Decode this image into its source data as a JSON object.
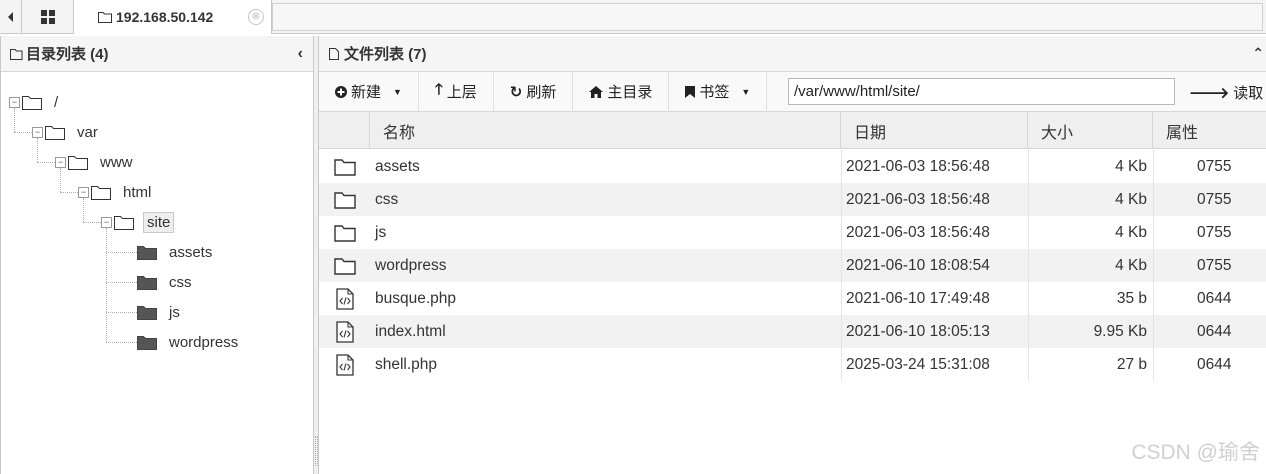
{
  "tabbar": {
    "active_tab": "192.168.50.142",
    "close_glyph": "⊗"
  },
  "left_panel": {
    "title": "目录列表 (4)",
    "tree": [
      {
        "label": "/",
        "depth": 0,
        "type": "folder-open"
      },
      {
        "label": "var",
        "depth": 1,
        "type": "folder-open"
      },
      {
        "label": "www",
        "depth": 2,
        "type": "folder-open"
      },
      {
        "label": "html",
        "depth": 3,
        "type": "folder-open"
      },
      {
        "label": "site",
        "depth": 4,
        "type": "folder-open",
        "selected": true
      },
      {
        "label": "assets",
        "depth": 5,
        "type": "folder-closed"
      },
      {
        "label": "css",
        "depth": 5,
        "type": "folder-closed"
      },
      {
        "label": "js",
        "depth": 5,
        "type": "folder-closed"
      },
      {
        "label": "wordpress",
        "depth": 5,
        "type": "folder-closed"
      }
    ]
  },
  "right_panel": {
    "title": "文件列表 (7)",
    "toolbar": {
      "new_label": "新建",
      "up_label": "上层",
      "refresh_label": "刷新",
      "home_label": "主目录",
      "bookmark_label": "书签",
      "path_value": "/var/www/html/site/",
      "read_label": "读取"
    },
    "columns": [
      "名称",
      "日期",
      "大小",
      "属性"
    ],
    "files": [
      {
        "icon": "folder-icon",
        "name": "assets",
        "date": "2021-06-03 18:56:48",
        "size": "4 Kb",
        "attr": "0755"
      },
      {
        "icon": "folder-icon",
        "name": "css",
        "date": "2021-06-03 18:56:48",
        "size": "4 Kb",
        "attr": "0755"
      },
      {
        "icon": "folder-icon",
        "name": "js",
        "date": "2021-06-03 18:56:48",
        "size": "4 Kb",
        "attr": "0755"
      },
      {
        "icon": "folder-icon",
        "name": "wordpress",
        "date": "2021-06-10 18:08:54",
        "size": "4 Kb",
        "attr": "0755"
      },
      {
        "icon": "code-file-icon",
        "name": "busque.php",
        "date": "2021-06-10 17:49:48",
        "size": "35 b",
        "attr": "0644"
      },
      {
        "icon": "code-file-icon",
        "name": "index.html",
        "date": "2021-06-10 18:05:13",
        "size": "9.95 Kb",
        "attr": "0644"
      },
      {
        "icon": "code-file-icon",
        "name": "shell.php",
        "date": "2025-03-24 15:31:08",
        "size": "27 b",
        "attr": "0644"
      }
    ]
  },
  "watermark": "CSDN @瑜舍"
}
